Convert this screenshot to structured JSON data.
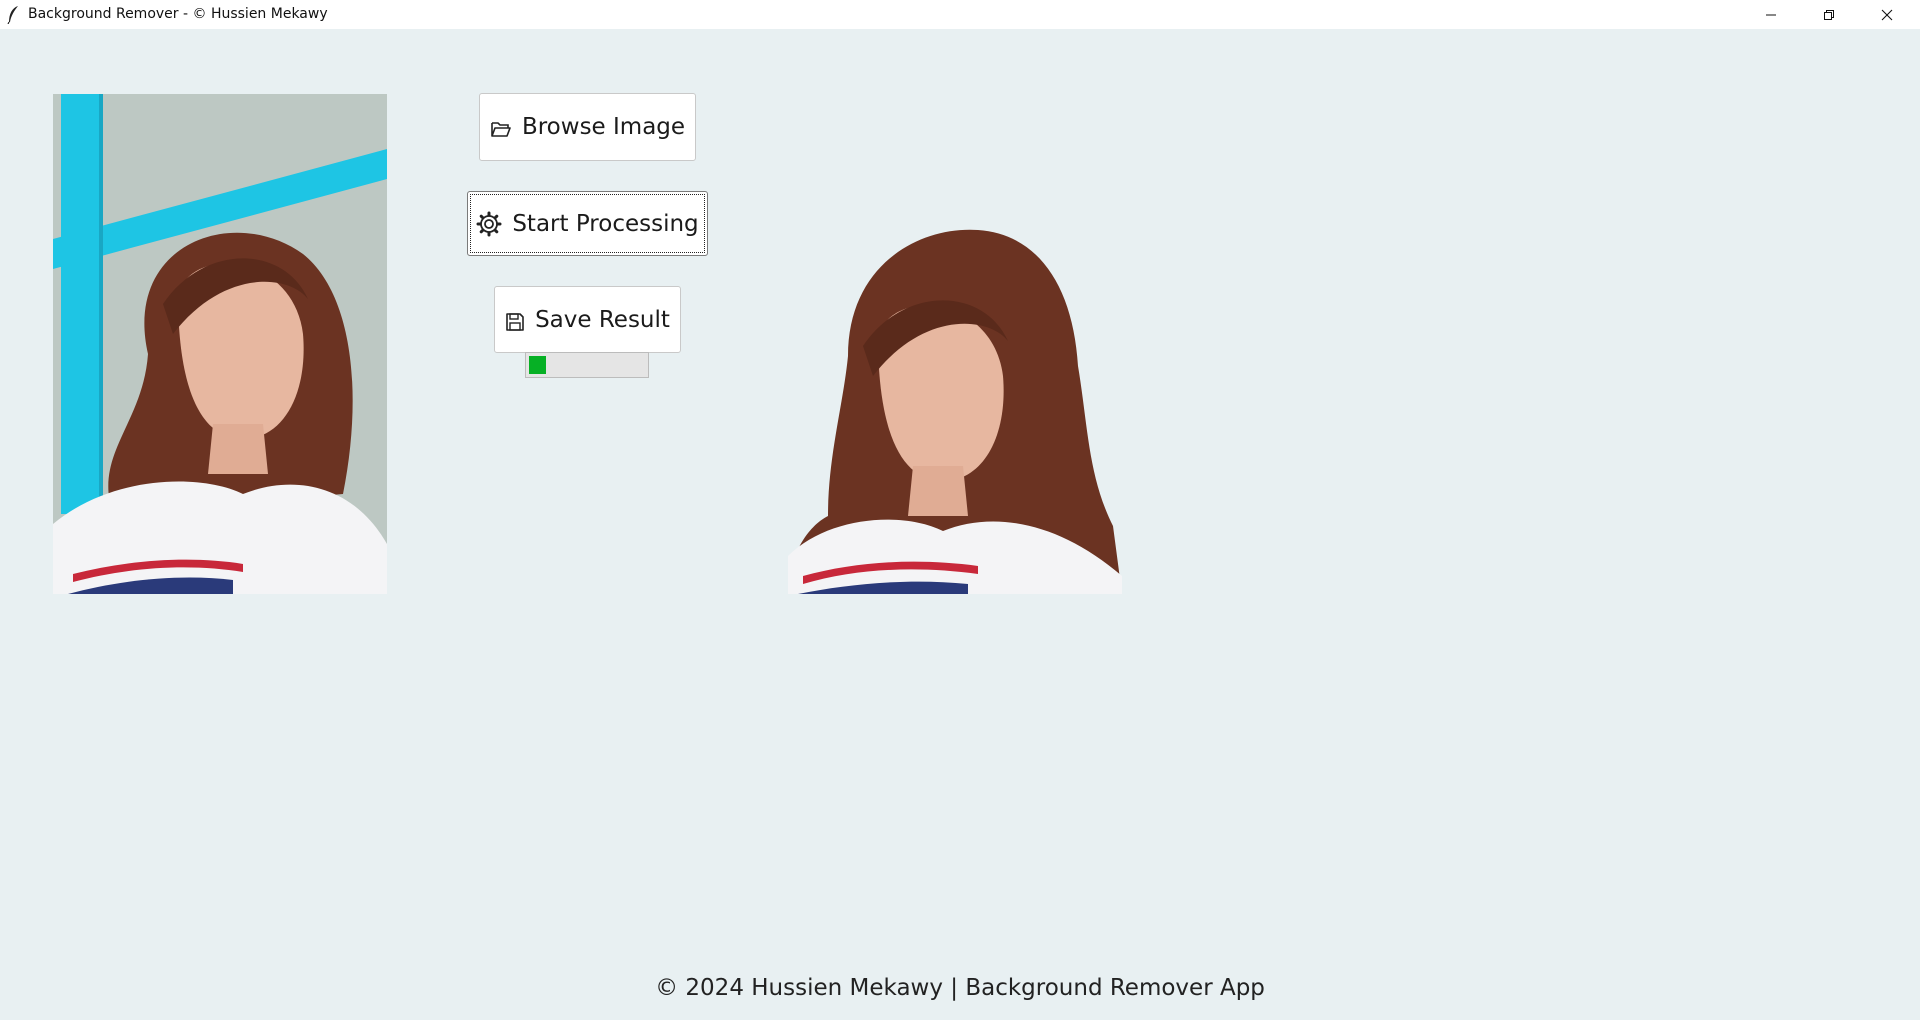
{
  "window": {
    "title": "Background Remover - © Hussien Mekawy",
    "icon": "feather-icon",
    "controls": [
      "minimize-icon",
      "restore-icon",
      "close-icon"
    ]
  },
  "buttons": {
    "browse": {
      "label": "Browse Image",
      "icon": "folder-open-icon"
    },
    "process": {
      "label": "Start Processing",
      "icon": "gear-icon"
    },
    "save": {
      "label": "Save Result",
      "icon": "floppy-disk-icon"
    }
  },
  "progress": {
    "value": 0.15,
    "color": "#06b025"
  },
  "images": {
    "original": {
      "description_icon": "original-photo"
    },
    "result": {
      "description_icon": "background-removed-photo"
    }
  },
  "footer": {
    "text": "© 2024 Hussien Mekawy | Background Remover App"
  },
  "colors": {
    "background": "#e8f0f2",
    "titlebar": "#ffffff",
    "accent_cyan": "#1ec5e4"
  }
}
